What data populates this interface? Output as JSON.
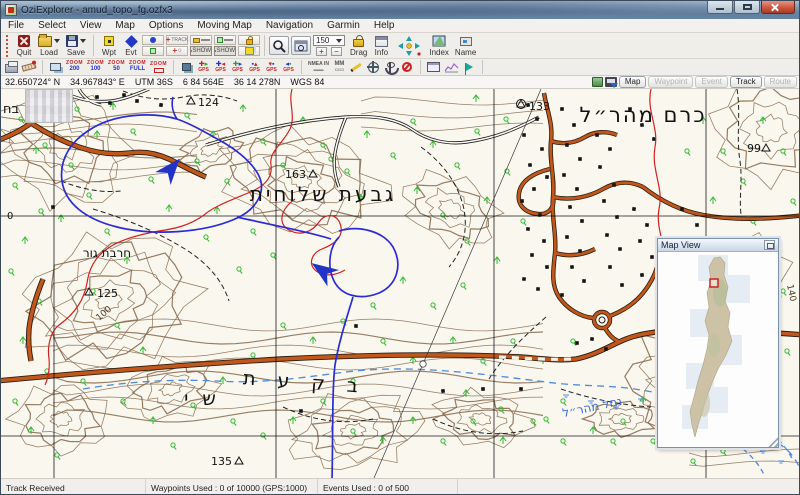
{
  "window": {
    "title": "OziExplorer - amud_topo_fg.ozfx3"
  },
  "menu": {
    "items": [
      "File",
      "Select",
      "View",
      "Map",
      "Options",
      "Moving Map",
      "Navigation",
      "Garmin",
      "Help"
    ]
  },
  "toolbar": {
    "quit": "Quit",
    "load": "Load",
    "save": "Save",
    "wpt": "Wpt",
    "evt": "Evt",
    "track": "TRACK",
    "show_wpt": "SHOW",
    "show_evt": "SHOW",
    "zoom_level": "150",
    "drag": "Drag",
    "info": "Info",
    "index": "Index",
    "name": "Name"
  },
  "toolbar2": {
    "zoom_buttons": [
      {
        "t": "ZOOM",
        "b": "200"
      },
      {
        "t": "ZOOM",
        "b": "100"
      },
      {
        "t": "ZOOM",
        "b": "50"
      },
      {
        "t": "ZOOM",
        "b": "FULL"
      },
      {
        "t": "ZOOM",
        "b": ""
      }
    ],
    "gps": "GPS",
    "nmea": "NMEA IN",
    "mm": "MM"
  },
  "coordbar": {
    "lat": "32.650724° N",
    "lon": "34.967843° E",
    "zone": "UTM  36S",
    "easting": "6 84 564E",
    "northing": "36 14 278N",
    "datum": "WGS 84",
    "buttons": [
      {
        "label": "Map"
      },
      {
        "label": "Waypoint"
      },
      {
        "label": "Event"
      },
      {
        "label": "Track"
      },
      {
        "label": "Route"
      }
    ]
  },
  "map": {
    "labels": {
      "spot124": "124",
      "spot163": "163",
      "spot125": "125",
      "spot133": "133",
      "spot99": "99",
      "spot135": "135",
      "contour100": "100",
      "contour140": "140",
      "grid0": "0",
      "edge_fragment": "בח",
      "givat": "גבעת שלוחית",
      "kerem": "כרם מהר״ל",
      "hirbat": "חרבת גור",
      "bikat": "בקעת",
      "bikat2": "שי",
      "nahal": "נחל מהר״ל"
    }
  },
  "map_view": {
    "title": "Map View"
  },
  "statusbar": {
    "track": "Track Received",
    "waypoints": "Waypoints Used : 0 of 10000   (GPS:1000)",
    "events": "Events Used : 0 of 500"
  }
}
